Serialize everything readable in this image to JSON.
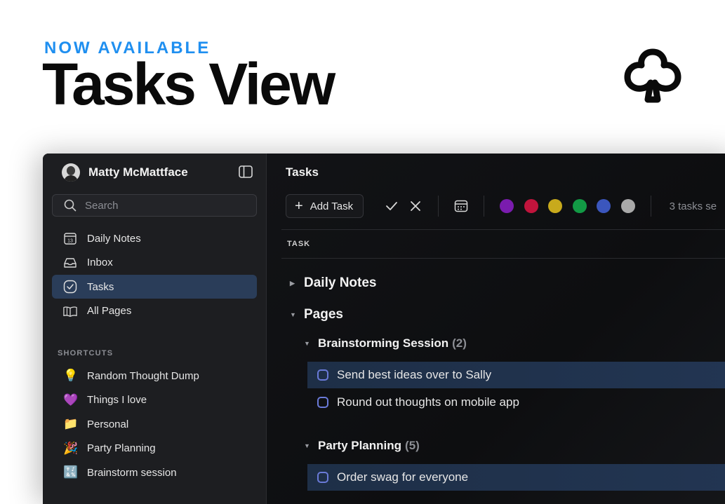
{
  "hero": {
    "kicker": "NOW AVAILABLE",
    "title": "Tasks View",
    "logo_icon": "club-logo-icon"
  },
  "user": {
    "name": "Matty McMattface"
  },
  "search": {
    "placeholder": "Search"
  },
  "nav": [
    {
      "label": "Daily Notes",
      "icon": "calendar-13-icon",
      "active": false
    },
    {
      "label": "Inbox",
      "icon": "inbox-tray-icon",
      "active": false
    },
    {
      "label": "Tasks",
      "icon": "check-circle-icon",
      "active": true
    },
    {
      "label": "All Pages",
      "icon": "book-pages-icon",
      "active": false
    }
  ],
  "shortcuts": {
    "label": "SHORTCUTS",
    "items": [
      {
        "emoji": "💡",
        "label": "Random Thought Dump"
      },
      {
        "emoji": "💜",
        "label": "Things I love"
      },
      {
        "emoji": "📁",
        "label": "Personal"
      },
      {
        "emoji": "🎉",
        "label": "Party Planning"
      },
      {
        "emoji": "🔣",
        "label": "Brainstorm session"
      }
    ]
  },
  "main": {
    "title": "Tasks",
    "add_task_label": "Add Task",
    "task_count": "3 tasks se",
    "column_header": "TASK",
    "colors": [
      "#7a1cae",
      "#c0143c",
      "#c8aa1c",
      "#129a45",
      "#3b56bd",
      "#a9a9a9"
    ],
    "groups": {
      "daily_notes": "Daily Notes",
      "pages": "Pages",
      "brainstorming": {
        "title": "Brainstorming Session",
        "count": "(2)"
      },
      "party": {
        "title": "Party Planning",
        "count": "(5)"
      }
    },
    "tasks": {
      "t1": "Send best ideas over to Sally",
      "t2": "Round out thoughts on mobile app",
      "t3": "Order swag for everyone"
    }
  }
}
